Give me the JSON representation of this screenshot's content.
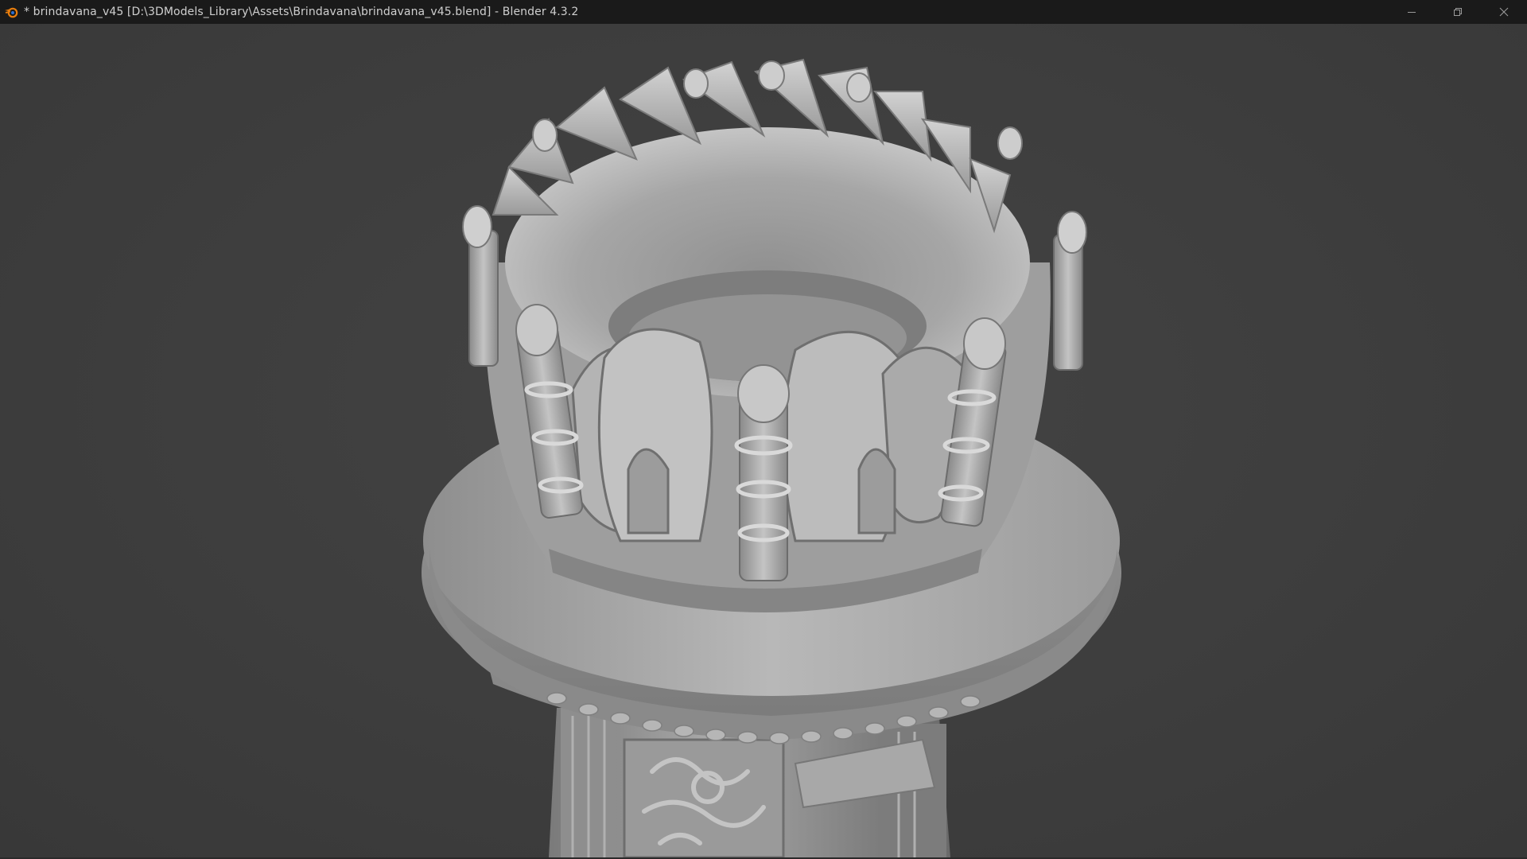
{
  "window": {
    "title": "* brindavana_v45 [D:\\3DModels_Library\\Assets\\Brindavana\\brindavana_v45.blend] - Blender 4.3.2",
    "app_icon": "blender-logo-icon",
    "controls": {
      "minimize_icon": "minimize-icon",
      "restore_icon": "restore-icon",
      "close_icon": "close-icon"
    }
  },
  "colors": {
    "titlebar_bg": "#1a1a1a",
    "viewport_bg": "#3c3c3c",
    "blender_orange": "#e87d0d",
    "model_light": "#c8c8c8",
    "model_mid": "#a4a4a4",
    "model_dark": "#6e6e6e"
  }
}
